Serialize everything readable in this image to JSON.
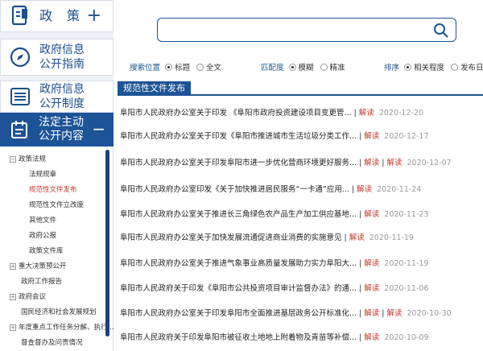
{
  "sidebar": {
    "cards": [
      {
        "label": "政策"
      },
      {
        "label_line1": "政府信息",
        "label_line2": "公开指南"
      },
      {
        "label_line1": "政府信息",
        "label_line2": "公开制度"
      }
    ],
    "plus": "+",
    "active": {
      "label_line1": "法定主动",
      "label_line2": "公开内容",
      "toggle": "−"
    },
    "tree": [
      {
        "label": "政策法规",
        "toggle": "−",
        "level": 0
      },
      {
        "label": "法规规章",
        "level": 1
      },
      {
        "label": "规范性文件发布",
        "level": 1,
        "active": true
      },
      {
        "label": "规范性文件立改废",
        "level": 1
      },
      {
        "label": "其他文件",
        "level": 1
      },
      {
        "label": "政府公报",
        "level": 1
      },
      {
        "label": "政策文件库",
        "level": 1
      },
      {
        "label": "重大决策预公开",
        "toggle": "+",
        "level": 0
      },
      {
        "label": "政府工作报告",
        "level": 0
      },
      {
        "label": "政府会议",
        "toggle": "+",
        "level": 0
      },
      {
        "label": "国民经济和社会发展规划",
        "level": 0
      },
      {
        "label": "年度重点工作任务分解、执行...",
        "toggle": "+",
        "level": 0
      },
      {
        "label": "督查督办及问责情况",
        "level": 0
      }
    ]
  },
  "search": {
    "placeholder": "",
    "value": ""
  },
  "filters": {
    "position": {
      "label": "搜索位置",
      "options": [
        {
          "label": "标题",
          "on": true
        },
        {
          "label": "全文",
          "on": false
        }
      ]
    },
    "match": {
      "label": "匹配度",
      "options": [
        {
          "label": "模糊",
          "on": true
        },
        {
          "label": "精准",
          "on": false
        }
      ]
    },
    "sort": {
      "label": "排序",
      "options": [
        {
          "label": "相关程度",
          "on": true
        },
        {
          "label": "发布日期",
          "on": false
        }
      ]
    }
  },
  "section_title": "规范性文件发布",
  "list": [
    {
      "title": "阜阳市人民政府办公室关于印发 《阜阳市政府投资建设项目变更管...",
      "sep": "|",
      "read": "解读",
      "date": "2020-12-20"
    },
    {
      "title": "阜阳市人民政府办公室关于印发《阜阳市推进城市生活垃圾分类工作...",
      "sep": "|",
      "read": "解读",
      "date": "2020-12-17"
    },
    {
      "title": "阜阳市人民政府办公室关于印发阜阳市进一步优化营商环境更好服务...",
      "sep": "|",
      "read": "解读",
      "sep2": "|",
      "read2": "解读",
      "date": "2020-12-07"
    },
    {
      "title": "阜阳市人民政府办公室印发《关于加快推进居民服务“一卡通”应用...",
      "sep": "|",
      "read": "解读",
      "date": "2020-11-24"
    },
    {
      "title": "阜阳市人民政府办公室关于推进长三角绿色农产品生产加工供应基地...",
      "sep": "|",
      "read": "解读",
      "date": "2020-11-23"
    },
    {
      "title": "阜阳市人民政府办公室关于加快发展流通促进商业消费的实施意见",
      "sep": "|",
      "read": "解读",
      "date": "2020-11-19"
    },
    {
      "title": "阜阳市人民政府办公室关于推进气象事业高质量发展助力实力阜阳大...",
      "sep": "|",
      "read": "解读",
      "date": "2020-11-19"
    },
    {
      "title": "阜阳市人民政府关于印发《阜阳市公共投资项目审计监督办法》的通...",
      "sep": "|",
      "read": "解读",
      "date": "2020-11-06"
    },
    {
      "title": "阜阳市人民政府办公室关于印发阜阳市全面推进基层政务公开标准化...",
      "sep": "|",
      "read": "解读",
      "sep2": "|",
      "read2": "解读",
      "date": "2020-10-30"
    },
    {
      "title": "阜阳市人民政府关于印发阜阳市被征收土地地上附着物及青苗等补偿...",
      "sep": "|",
      "read": "解读",
      "date": "2020-10-09"
    }
  ],
  "colors": {
    "accent": "#1d5497",
    "read": "#c0392b",
    "date": "#999999"
  }
}
